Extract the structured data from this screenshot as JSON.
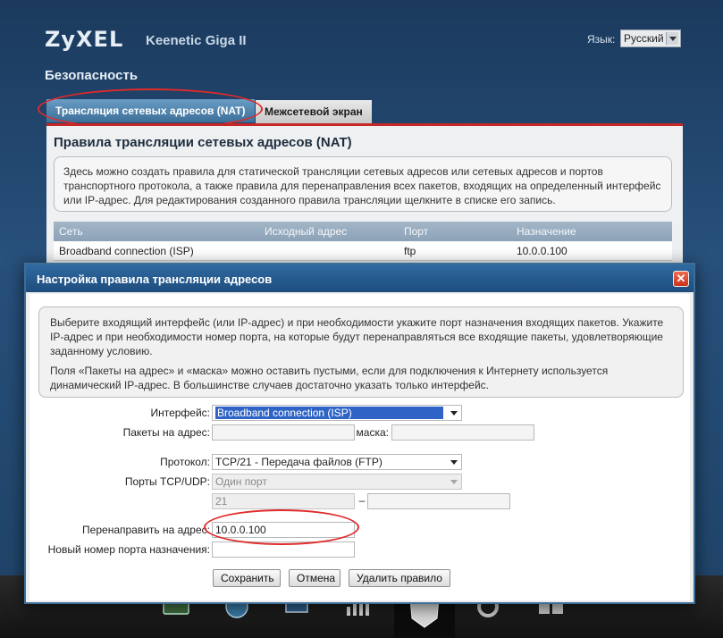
{
  "header": {
    "logo": "ZyXEL",
    "model": "Keenetic Giga II",
    "language_label": "Язык:",
    "language_value": "Русский"
  },
  "section_title": "Безопасность",
  "tabs": [
    {
      "label": "Трансляция сетевых адресов (NAT)",
      "active": true
    },
    {
      "label": "Межсетевой экран",
      "active": false
    }
  ],
  "nat_panel": {
    "title": "Правила трансляции сетевых адресов (NAT)",
    "description": "Здесь можно создать правила для статической трансляции сетевых адресов или сетевых адресов и портов транспортного протокола, а также правила для перенаправления всех пакетов, входящих на определенный интерфейс или IP-адрес. Для редактирования созданного правила трансляции щелкните в списке его запись.",
    "columns": [
      "Сеть",
      "Исходный адрес",
      "Порт",
      "Назначение"
    ],
    "rows": [
      {
        "network": "Broadband connection (ISP)",
        "source": "",
        "port": "ftp",
        "destination": "10.0.0.100"
      }
    ]
  },
  "dialog": {
    "title": "Настройка правила трансляции адресов",
    "info_p1": "Выберите входящий интерфейс (или IP-адрес) и при необходимости укажите порт назначения входящих пакетов. Укажите IP-адрес и при необходимости номер порта, на которые будут перенаправляться все входящие пакеты, удовлетворяющие заданному условию.",
    "info_p2": "Поля «Пакеты на адрес» и «маска» можно оставить пустыми, если для подключения к Интернету используется динамический IP-адрес. В большинстве случаев достаточно указать только интерфейс.",
    "interface_label": "Интерфейс:",
    "interface_value": "Broadband connection (ISP)",
    "packets_label": "Пакеты на адрес:",
    "packets_value": "",
    "mask_label": "маска:",
    "mask_value": "",
    "protocol_label": "Протокол:",
    "protocol_value": "TCP/21 - Передача файлов (FTP)",
    "ports_label": "Порты TCP/UDP:",
    "ports_value": "Один порт",
    "port_from": "21",
    "port_dash": "–",
    "port_to": "",
    "redirect_label": "Перенаправить на адрес:",
    "redirect_value": "10.0.0.100",
    "new_port_label": "Новый номер порта назначения:",
    "new_port_value": "",
    "save_button": "Сохранить",
    "cancel_button": "Отмена",
    "delete_button": "Удалить правило",
    "close_glyph": "✕"
  },
  "colors": {
    "accent": "#2f64c6",
    "header_bg": "#1e4d7d",
    "highlight_circle": "#e02a2a"
  },
  "bottom_nav_icons": [
    "monitor-icon",
    "globe-icon",
    "network-icon",
    "signal-bars-icon",
    "shield-icon",
    "gear-icon",
    "apps-icon"
  ]
}
